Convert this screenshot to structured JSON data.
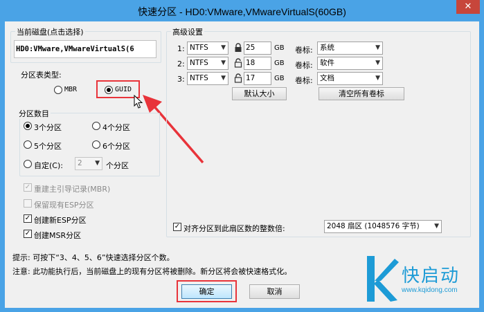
{
  "window": {
    "title": "快速分区 - HD0:VMware,VMwareVirtualS(60GB)",
    "close_glyph": "✕"
  },
  "disk": {
    "group_title": "当前磁盘(点击选择)",
    "value": "HD0:VMware,VMwareVirtualS(6"
  },
  "partition_table": {
    "label": "分区表类型:",
    "options": [
      {
        "label": "MBR",
        "checked": false
      },
      {
        "label": "GUID",
        "checked": true
      }
    ]
  },
  "partition_count": {
    "group_title": "分区数目",
    "options": [
      {
        "label": "3个分区",
        "checked": true
      },
      {
        "label": "4个分区",
        "checked": false
      },
      {
        "label": "5个分区",
        "checked": false
      },
      {
        "label": "6个分区",
        "checked": false
      },
      {
        "label": "自定(C):",
        "checked": false
      }
    ],
    "custom_value": "2",
    "custom_suffix": "个分区"
  },
  "options": [
    {
      "label": "重建主引导记录(MBR)",
      "checked": true,
      "disabled": true
    },
    {
      "label": "保留现有ESP分区",
      "checked": false,
      "disabled": true
    },
    {
      "label": "创建新ESP分区",
      "checked": true,
      "disabled": false
    },
    {
      "label": "创建MSR分区",
      "checked": true,
      "disabled": false
    }
  ],
  "advanced": {
    "group_title": "高级设置",
    "rows": [
      {
        "index": "1:",
        "fs": "NTFS",
        "size": "25",
        "unit": "GB",
        "vol_label_text": "卷标:",
        "volume": "系统",
        "locked": true
      },
      {
        "index": "2:",
        "fs": "NTFS",
        "size": "18",
        "unit": "GB",
        "vol_label_text": "卷标:",
        "volume": "软件",
        "locked": false
      },
      {
        "index": "3:",
        "fs": "NTFS",
        "size": "17",
        "unit": "GB",
        "vol_label_text": "卷标:",
        "volume": "文档",
        "locked": false
      }
    ],
    "default_size_button": "默认大小",
    "clear_labels_button": "清空所有卷标",
    "align_label": "对齐分区到此扇区数的整数倍:",
    "align_checked": true,
    "align_value": "2048 扇区 (1048576 字节)"
  },
  "notes": {
    "tip": "提示: 可按下“3、4、5、6”快速选择分区个数。",
    "warning": "注意: 此功能执行后，当前磁盘上的现有分区将被删除。新分区将会被快速格式化。"
  },
  "buttons": {
    "ok": "确定",
    "cancel": "取消"
  },
  "brand": {
    "name": "快启动",
    "url": "www.kqidong.com",
    "color": "#1d9bd6"
  },
  "colors": {
    "title_bar": "#4aa3e6",
    "close_button": "#c7463b",
    "highlight": "#e8333a"
  }
}
